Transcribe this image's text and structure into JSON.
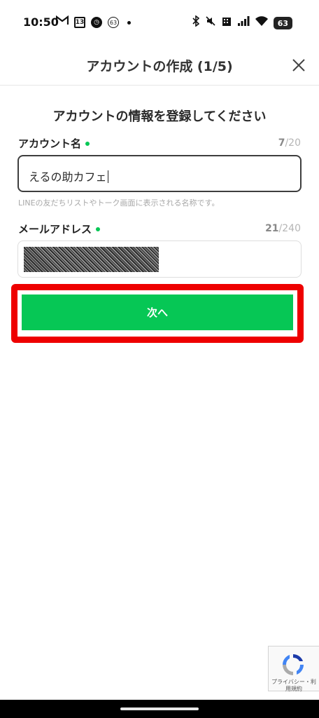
{
  "status_bar": {
    "time": "10:50",
    "calendar_day": "13",
    "notif_count": "63",
    "battery": "63",
    "icons_left": [
      "gmail-icon",
      "calendar-icon",
      "timer-icon",
      "badge-icon",
      "dot-icon"
    ],
    "icons_right": [
      "bluetooth-icon",
      "mute-icon",
      "building-icon",
      "signal-icon",
      "wifi-icon",
      "battery-icon"
    ]
  },
  "header": {
    "title": "アカウントの作成 (1/5)"
  },
  "form": {
    "section_title": "アカウントの情報を登録してください",
    "account_name": {
      "label": "アカウント名",
      "count_current": "7",
      "count_max": "/20",
      "value": "えるの助カフェ",
      "helper": "LINEの友だちリストやトーク画面に表示される名称です。"
    },
    "email": {
      "label": "メールアドレス",
      "count_current": "21",
      "count_max": "/240"
    },
    "next_button": "次へ"
  },
  "recaptcha": {
    "text_line1": "プライバシー・利",
    "text_line2": "用規約"
  },
  "colors": {
    "accent_green": "#06c755",
    "highlight_red": "#ee0000"
  }
}
